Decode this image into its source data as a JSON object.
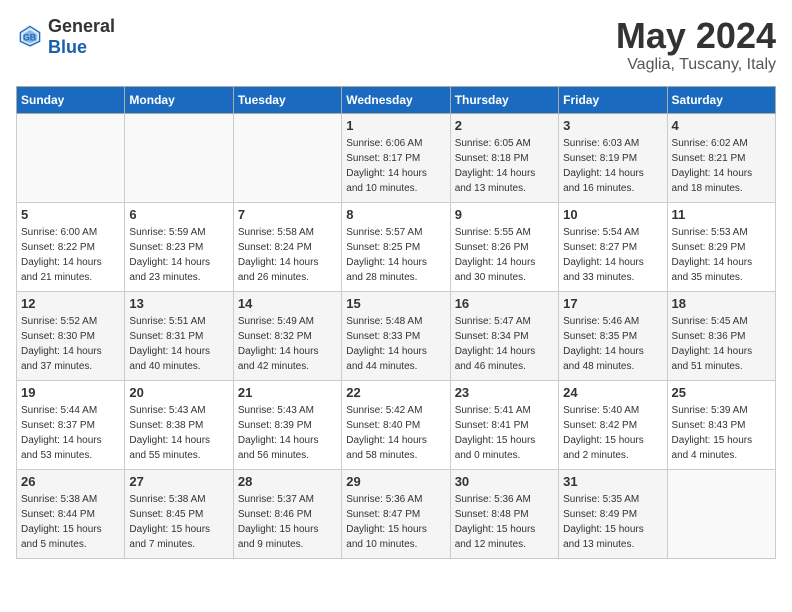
{
  "header": {
    "logo_general": "General",
    "logo_blue": "Blue",
    "month": "May 2024",
    "location": "Vaglia, Tuscany, Italy"
  },
  "weekdays": [
    "Sunday",
    "Monday",
    "Tuesday",
    "Wednesday",
    "Thursday",
    "Friday",
    "Saturday"
  ],
  "weeks": [
    [
      {
        "day": "",
        "info": ""
      },
      {
        "day": "",
        "info": ""
      },
      {
        "day": "",
        "info": ""
      },
      {
        "day": "1",
        "info": "Sunrise: 6:06 AM\nSunset: 8:17 PM\nDaylight: 14 hours\nand 10 minutes."
      },
      {
        "day": "2",
        "info": "Sunrise: 6:05 AM\nSunset: 8:18 PM\nDaylight: 14 hours\nand 13 minutes."
      },
      {
        "day": "3",
        "info": "Sunrise: 6:03 AM\nSunset: 8:19 PM\nDaylight: 14 hours\nand 16 minutes."
      },
      {
        "day": "4",
        "info": "Sunrise: 6:02 AM\nSunset: 8:21 PM\nDaylight: 14 hours\nand 18 minutes."
      }
    ],
    [
      {
        "day": "5",
        "info": "Sunrise: 6:00 AM\nSunset: 8:22 PM\nDaylight: 14 hours\nand 21 minutes."
      },
      {
        "day": "6",
        "info": "Sunrise: 5:59 AM\nSunset: 8:23 PM\nDaylight: 14 hours\nand 23 minutes."
      },
      {
        "day": "7",
        "info": "Sunrise: 5:58 AM\nSunset: 8:24 PM\nDaylight: 14 hours\nand 26 minutes."
      },
      {
        "day": "8",
        "info": "Sunrise: 5:57 AM\nSunset: 8:25 PM\nDaylight: 14 hours\nand 28 minutes."
      },
      {
        "day": "9",
        "info": "Sunrise: 5:55 AM\nSunset: 8:26 PM\nDaylight: 14 hours\nand 30 minutes."
      },
      {
        "day": "10",
        "info": "Sunrise: 5:54 AM\nSunset: 8:27 PM\nDaylight: 14 hours\nand 33 minutes."
      },
      {
        "day": "11",
        "info": "Sunrise: 5:53 AM\nSunset: 8:29 PM\nDaylight: 14 hours\nand 35 minutes."
      }
    ],
    [
      {
        "day": "12",
        "info": "Sunrise: 5:52 AM\nSunset: 8:30 PM\nDaylight: 14 hours\nand 37 minutes."
      },
      {
        "day": "13",
        "info": "Sunrise: 5:51 AM\nSunset: 8:31 PM\nDaylight: 14 hours\nand 40 minutes."
      },
      {
        "day": "14",
        "info": "Sunrise: 5:49 AM\nSunset: 8:32 PM\nDaylight: 14 hours\nand 42 minutes."
      },
      {
        "day": "15",
        "info": "Sunrise: 5:48 AM\nSunset: 8:33 PM\nDaylight: 14 hours\nand 44 minutes."
      },
      {
        "day": "16",
        "info": "Sunrise: 5:47 AM\nSunset: 8:34 PM\nDaylight: 14 hours\nand 46 minutes."
      },
      {
        "day": "17",
        "info": "Sunrise: 5:46 AM\nSunset: 8:35 PM\nDaylight: 14 hours\nand 48 minutes."
      },
      {
        "day": "18",
        "info": "Sunrise: 5:45 AM\nSunset: 8:36 PM\nDaylight: 14 hours\nand 51 minutes."
      }
    ],
    [
      {
        "day": "19",
        "info": "Sunrise: 5:44 AM\nSunset: 8:37 PM\nDaylight: 14 hours\nand 53 minutes."
      },
      {
        "day": "20",
        "info": "Sunrise: 5:43 AM\nSunset: 8:38 PM\nDaylight: 14 hours\nand 55 minutes."
      },
      {
        "day": "21",
        "info": "Sunrise: 5:43 AM\nSunset: 8:39 PM\nDaylight: 14 hours\nand 56 minutes."
      },
      {
        "day": "22",
        "info": "Sunrise: 5:42 AM\nSunset: 8:40 PM\nDaylight: 14 hours\nand 58 minutes."
      },
      {
        "day": "23",
        "info": "Sunrise: 5:41 AM\nSunset: 8:41 PM\nDaylight: 15 hours\nand 0 minutes."
      },
      {
        "day": "24",
        "info": "Sunrise: 5:40 AM\nSunset: 8:42 PM\nDaylight: 15 hours\nand 2 minutes."
      },
      {
        "day": "25",
        "info": "Sunrise: 5:39 AM\nSunset: 8:43 PM\nDaylight: 15 hours\nand 4 minutes."
      }
    ],
    [
      {
        "day": "26",
        "info": "Sunrise: 5:38 AM\nSunset: 8:44 PM\nDaylight: 15 hours\nand 5 minutes."
      },
      {
        "day": "27",
        "info": "Sunrise: 5:38 AM\nSunset: 8:45 PM\nDaylight: 15 hours\nand 7 minutes."
      },
      {
        "day": "28",
        "info": "Sunrise: 5:37 AM\nSunset: 8:46 PM\nDaylight: 15 hours\nand 9 minutes."
      },
      {
        "day": "29",
        "info": "Sunrise: 5:36 AM\nSunset: 8:47 PM\nDaylight: 15 hours\nand 10 minutes."
      },
      {
        "day": "30",
        "info": "Sunrise: 5:36 AM\nSunset: 8:48 PM\nDaylight: 15 hours\nand 12 minutes."
      },
      {
        "day": "31",
        "info": "Sunrise: 5:35 AM\nSunset: 8:49 PM\nDaylight: 15 hours\nand 13 minutes."
      },
      {
        "day": "",
        "info": ""
      }
    ]
  ]
}
